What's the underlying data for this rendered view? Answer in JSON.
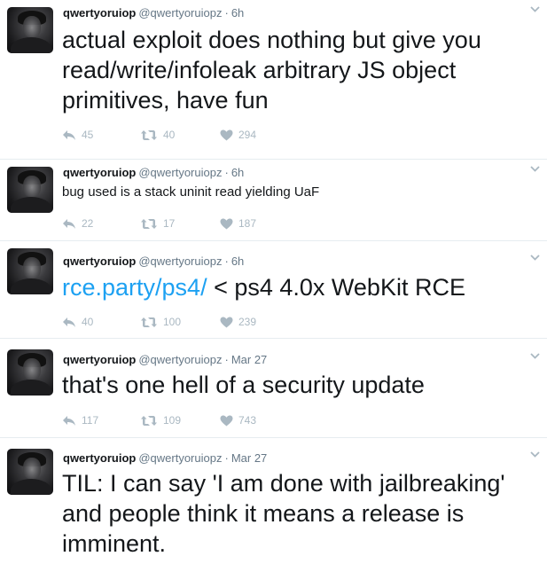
{
  "tweets": [
    {
      "name": "qwertyoruiop",
      "handle": "@qwertyoruiopz",
      "separator": "·",
      "time": "6h",
      "text_link": "",
      "text": "actual exploit does nothing but give you read/write/infoleak arbitrary JS object primitives, have fun",
      "replies": "45",
      "retweets": "40",
      "likes": "294"
    },
    {
      "name": "qwertyoruiop",
      "handle": "@qwertyoruiopz",
      "separator": "·",
      "time": "6h",
      "text_link": "",
      "text": "bug used is a stack uninit read yielding UaF",
      "replies": "22",
      "retweets": "17",
      "likes": "187"
    },
    {
      "name": "qwertyoruiop",
      "handle": "@qwertyoruiopz",
      "separator": "·",
      "time": "6h",
      "text_link": "rce.party/ps4/",
      "text": " < ps4 4.0x WebKit RCE",
      "replies": "40",
      "retweets": "100",
      "likes": "239"
    },
    {
      "name": "qwertyoruiop",
      "handle": "@qwertyoruiopz",
      "separator": "·",
      "time": "Mar 27",
      "text_link": "",
      "text": "that's one hell of a security update",
      "replies": "117",
      "retweets": "109",
      "likes": "743"
    },
    {
      "name": "qwertyoruiop",
      "handle": "@qwertyoruiopz",
      "separator": "·",
      "time": "Mar 27",
      "text_link": "",
      "text": "TIL: I can say 'I am done with jailbreaking' and people think it means a release is imminent.",
      "replies": "",
      "retweets": "",
      "likes": ""
    }
  ],
  "icons": {
    "reply": "reply-icon",
    "retweet": "retweet-icon",
    "like": "heart-icon",
    "more": "chevron-down-icon"
  },
  "colors": {
    "text": "#14171a",
    "secondary": "#657786",
    "action": "#aab8c2",
    "link": "#1da1f2",
    "divider": "#e6ecf0"
  }
}
